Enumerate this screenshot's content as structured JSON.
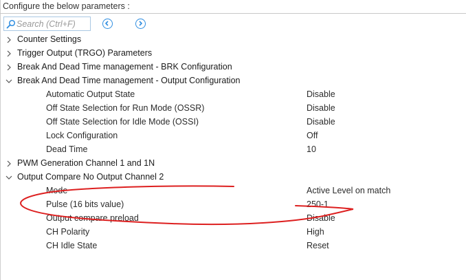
{
  "header": {
    "title": "Configure the below parameters :"
  },
  "search": {
    "placeholder": "Search (Ctrl+F)"
  },
  "icons": {
    "search": "magnifier-icon",
    "prev": "circle-arrow-left-icon",
    "next": "circle-arrow-right-icon",
    "collapsed": "chevron-right-icon",
    "expanded": "chevron-down-icon"
  },
  "colors": {
    "accent": "#2e8de0",
    "annotation": "#dd1f1f"
  },
  "groups": [
    {
      "label": "Counter Settings",
      "expanded": false,
      "params": []
    },
    {
      "label": "Trigger Output (TRGO) Parameters",
      "expanded": false,
      "params": []
    },
    {
      "label": "Break And Dead Time management - BRK Configuration",
      "expanded": false,
      "params": []
    },
    {
      "label": "Break And Dead Time management - Output Configuration",
      "expanded": true,
      "params": [
        {
          "name": "Automatic Output State",
          "value": "Disable"
        },
        {
          "name": "Off State Selection for Run Mode (OSSR)",
          "value": "Disable"
        },
        {
          "name": "Off State Selection for Idle Mode (OSSI)",
          "value": "Disable"
        },
        {
          "name": "Lock Configuration",
          "value": "Off"
        },
        {
          "name": "Dead Time",
          "value": "10"
        }
      ]
    },
    {
      "label": "PWM Generation Channel 1 and 1N",
      "expanded": false,
      "params": []
    },
    {
      "label": "Output Compare No Output Channel 2",
      "expanded": true,
      "params": [
        {
          "name": "Mode",
          "value": "Active Level on match"
        },
        {
          "name": "Pulse (16 bits value)",
          "value": "250-1"
        },
        {
          "name": "Output compare preload",
          "value": "Disable"
        },
        {
          "name": "CH Polarity",
          "value": "High"
        },
        {
          "name": "CH Idle State",
          "value": "Reset"
        }
      ]
    }
  ]
}
